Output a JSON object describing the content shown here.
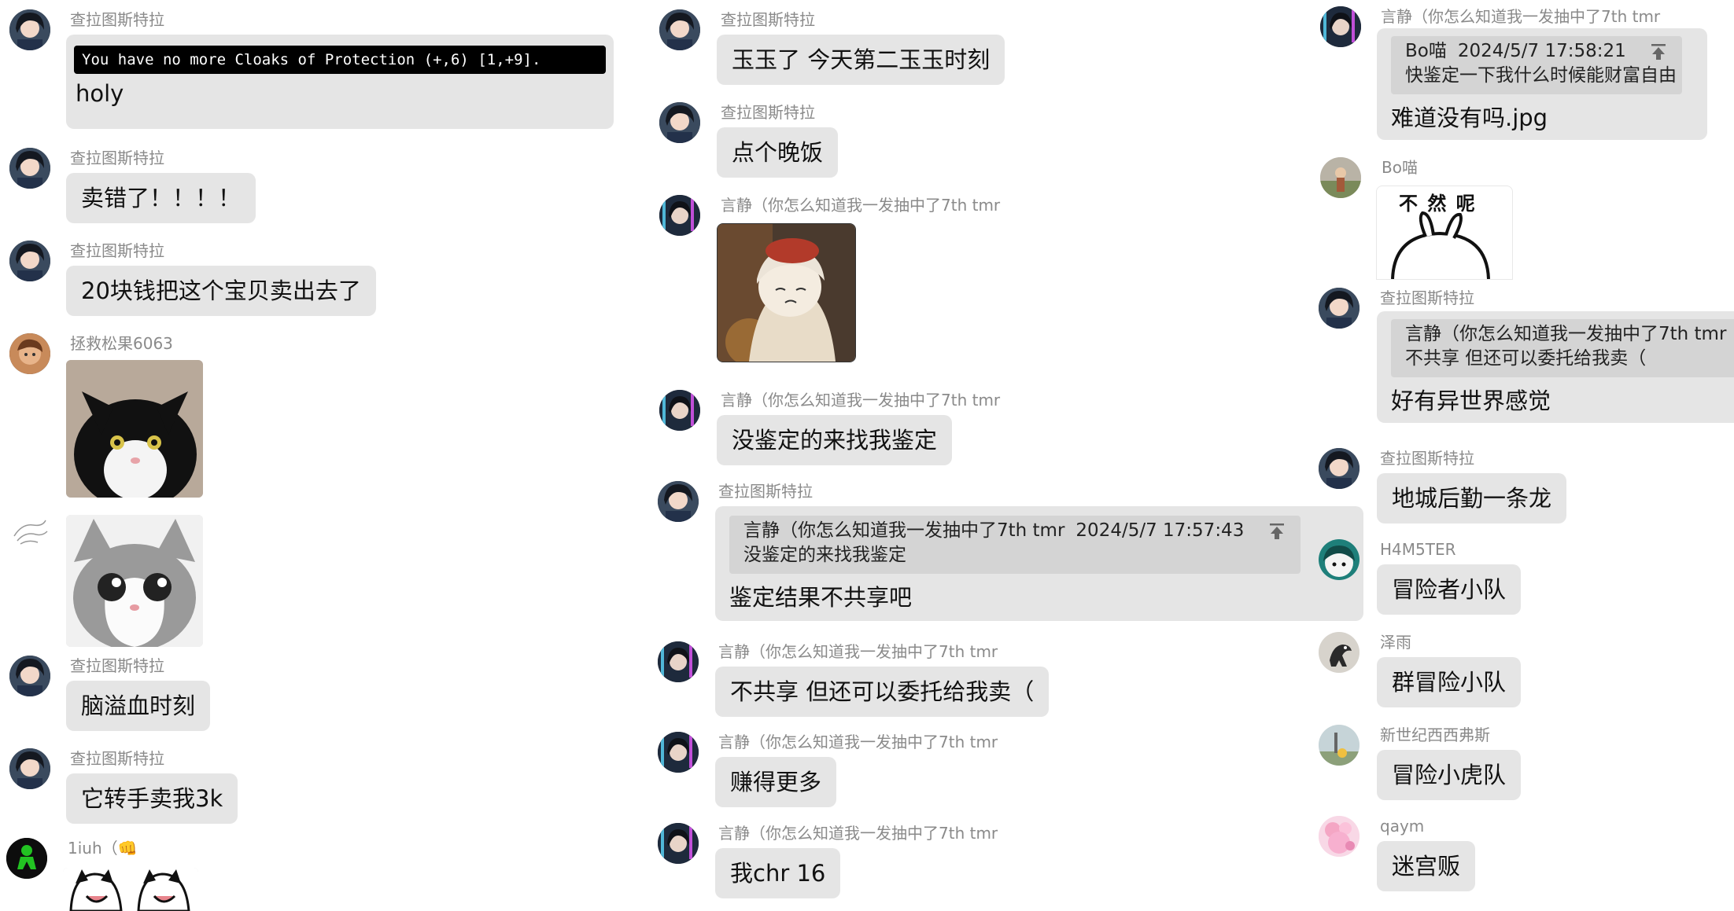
{
  "colors": {
    "bubble": "#e5e5e5",
    "quote": "#d4d4d4",
    "sender": "#8a8a8a"
  },
  "col1": {
    "m1": {
      "sender": "查拉图斯特拉",
      "game_line": "You have no more Cloaks of Protection (+,6) [1,+9].",
      "text": "holy"
    },
    "m2": {
      "sender": "查拉图斯特拉",
      "text": "卖错了！！！！"
    },
    "m3": {
      "sender": "查拉图斯特拉",
      "text": "20块钱把这个宝贝卖出去了"
    },
    "m4": {
      "sender": "拯救松果6063",
      "image": "tuxedo-cat-sticker"
    },
    "m5": {
      "image": "surprised-cat-sticker"
    },
    "m6": {
      "sender": "查拉图斯特拉",
      "text": "脑溢血时刻"
    },
    "m7": {
      "sender": "查拉图斯特拉",
      "text": "它转手卖我3k"
    },
    "m8": {
      "sender": "1iuh（👊",
      "image": "cartoon-cats-sticker"
    }
  },
  "col2": {
    "m1": {
      "sender": "查拉图斯特拉",
      "text": "玉玉了 今天第二玉玉时刻"
    },
    "m2": {
      "sender": "查拉图斯特拉",
      "text": "点个晚饭"
    },
    "m3": {
      "sender": "言静（你怎么知道我一发抽中了7th tmr",
      "image": "anime-girl-sticker"
    },
    "m4": {
      "sender": "言静（你怎么知道我一发抽中了7th tmr",
      "text": "没鉴定的来找我鉴定"
    },
    "m5": {
      "sender": "查拉图斯特拉",
      "quote": {
        "author": "言静（你怎么知道我一发抽中了7th tmr",
        "time": "2024/5/7 17:57:43",
        "text": "没鉴定的来找我鉴定"
      },
      "text": "鉴定结果不共享吧"
    },
    "m6": {
      "sender": "言静（你怎么知道我一发抽中了7th tmr",
      "text": "不共享 但还可以委托给我卖（"
    },
    "m7": {
      "sender": "言静（你怎么知道我一发抽中了7th tmr",
      "text": "赚得更多"
    },
    "m8": {
      "sender": "言静（你怎么知道我一发抽中了7th tmr",
      "text": "我chr 16"
    }
  },
  "col3": {
    "m1": {
      "sender": "言静（你怎么知道我一发抽中了7th tmr",
      "quote": {
        "author": "Bo喵",
        "time": "2024/5/7 17:58:21",
        "text": "快鉴定一下我什么时候能财富自由"
      },
      "text": "难道没有吗.jpg"
    },
    "m2": {
      "sender": "Bo喵",
      "sticker_text": "不 然 呢",
      "image": "bunny-sticker"
    },
    "m3": {
      "sender": "查拉图斯特拉",
      "quote": {
        "author": "言静（你怎么知道我一发抽中了7th tmr",
        "text": "不共享 但还可以委托给我卖（"
      },
      "text": "好有异世界感觉"
    },
    "m4": {
      "sender": "查拉图斯特拉",
      "text": "地城后勤一条龙"
    },
    "m5": {
      "sender": "H4M5TER",
      "text": "冒险者小队"
    },
    "m6": {
      "sender": "泽雨",
      "text": "群冒险小队"
    },
    "m7": {
      "sender": "新世纪西西弗斯",
      "text": "冒险小虎队"
    },
    "m8": {
      "sender": "qaym",
      "text": "迷宫贩"
    }
  }
}
